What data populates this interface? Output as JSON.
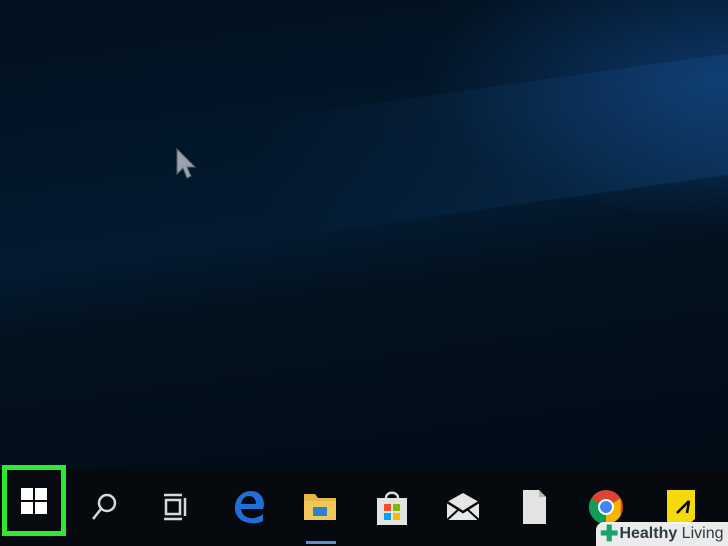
{
  "taskbar": {
    "start_icon": "windows-logo-icon",
    "items": [
      {
        "icon": "search-icon"
      },
      {
        "icon": "task-view-icon"
      },
      {
        "icon": "edge-icon"
      },
      {
        "icon": "file-explorer-icon"
      },
      {
        "icon": "store-icon"
      },
      {
        "icon": "mail-icon"
      },
      {
        "icon": "file-icon"
      },
      {
        "icon": "chrome-icon"
      },
      {
        "icon": "sticky-notes-icon"
      }
    ],
    "highlight_color": "#2ee834"
  },
  "watermark": {
    "bold_text": "Healthy",
    "text": " Living"
  }
}
